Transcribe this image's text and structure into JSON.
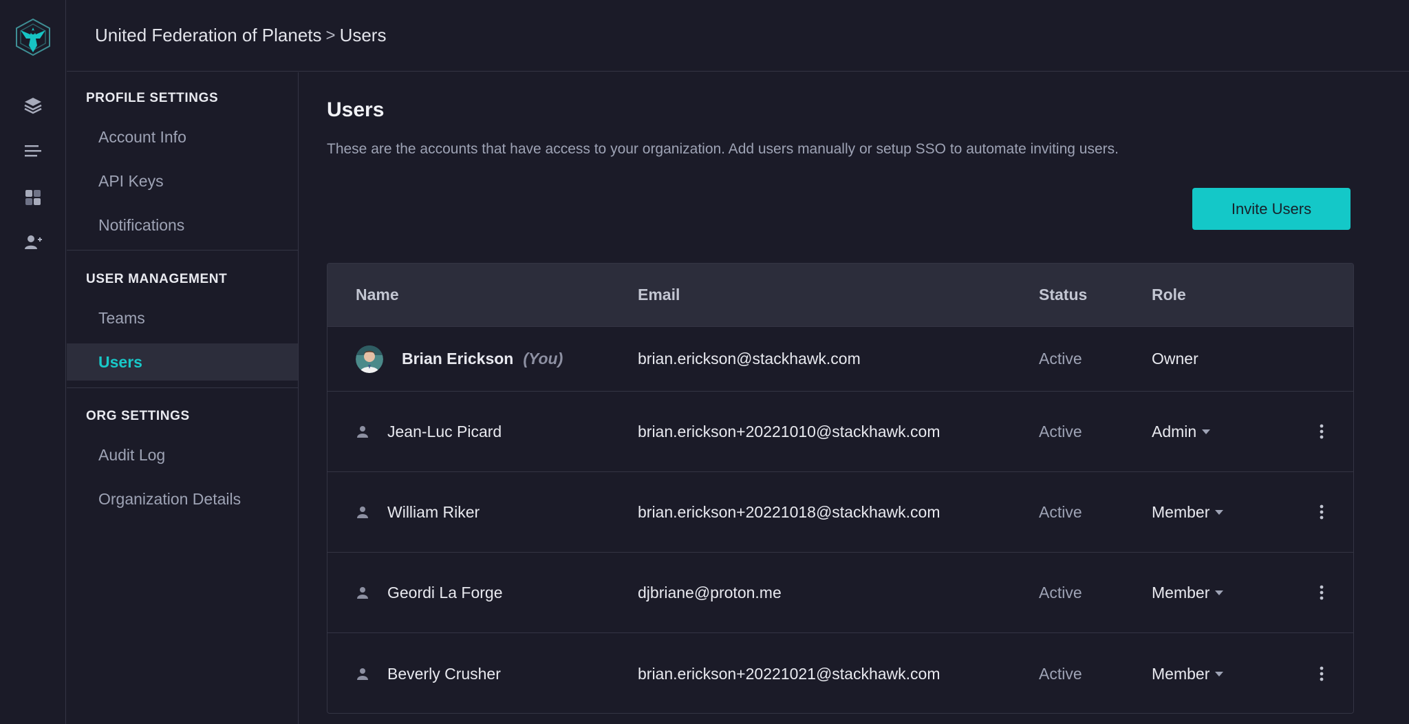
{
  "breadcrumb": {
    "org": "United Federation of Planets",
    "separator": ">",
    "page": "Users"
  },
  "rail": {
    "icons": [
      "logo-icon",
      "layers-icon",
      "list-icon",
      "dashboard-icon",
      "add-user-icon"
    ]
  },
  "settings": {
    "profile": {
      "title": "PROFILE SETTINGS",
      "items": [
        "Account Info",
        "API Keys",
        "Notifications"
      ]
    },
    "user_management": {
      "title": "USER MANAGEMENT",
      "items": [
        "Teams",
        "Users"
      ]
    },
    "org": {
      "title": "ORG SETTINGS",
      "items": [
        "Audit Log",
        "Organization Details"
      ]
    },
    "active_item": "Users"
  },
  "main": {
    "title": "Users",
    "description": "These are the accounts that have access to your organization. Add users manually or setup SSO to automate inviting users.",
    "invite_label": "Invite Users",
    "columns": {
      "name": "Name",
      "email": "Email",
      "status": "Status",
      "role": "Role"
    },
    "users": [
      {
        "name": "Brian Erickson",
        "you": "(You)",
        "email": "brian.erickson@stackhawk.com",
        "status": "Active",
        "role": "Owner"
      },
      {
        "name": "Jean-Luc Picard",
        "email": "brian.erickson+20221010@stackhawk.com",
        "status": "Active",
        "role": "Admin"
      },
      {
        "name": "William Riker",
        "email": "brian.erickson+20221018@stackhawk.com",
        "status": "Active",
        "role": "Member"
      },
      {
        "name": "Geordi La Forge",
        "email": "djbriane@proton.me",
        "status": "Active",
        "role": "Member"
      },
      {
        "name": "Beverly Crusher",
        "email": "brian.erickson+20221021@stackhawk.com",
        "status": "Active",
        "role": "Member"
      }
    ]
  },
  "colors": {
    "accent": "#14c8c8",
    "background": "#1b1b28",
    "panel": "#2c2d3b",
    "border": "#343544"
  }
}
